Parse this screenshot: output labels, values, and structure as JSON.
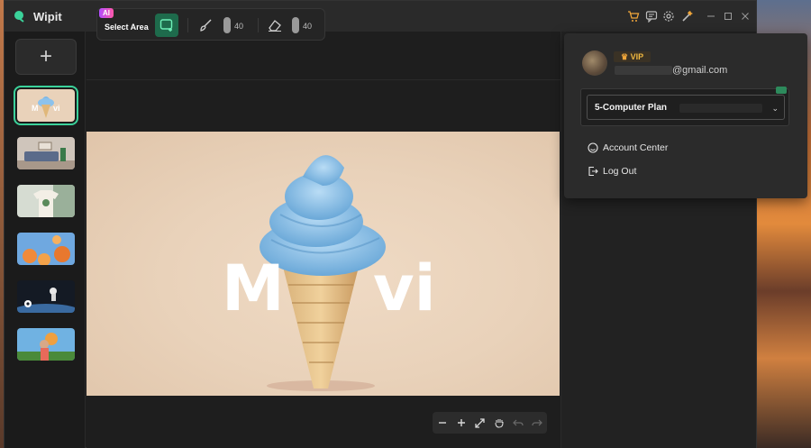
{
  "window": {
    "title": "Wipit"
  },
  "titlebar": {
    "icons": [
      "cart-icon",
      "chat-feedback-icon",
      "gear-icon",
      "tools-icon",
      "minimize-icon",
      "maximize-icon",
      "close-icon"
    ],
    "cart_color": "#f0a63a"
  },
  "sidebar": {
    "add_label": "+",
    "accent_color": "#3bd29a",
    "thumbs": [
      {
        "name": "thumb-ice-cream",
        "colors": [
          "#e9d2ba",
          "#7fb8e6"
        ],
        "active": true
      },
      {
        "name": "thumb-living-room",
        "colors": [
          "#bcb2a8",
          "#5a6b8a"
        ],
        "active": false
      },
      {
        "name": "thumb-tshirt",
        "colors": [
          "#cfd8cf",
          "#f3efe6"
        ],
        "active": false
      },
      {
        "name": "thumb-flowers",
        "colors": [
          "#6fa8e0",
          "#f08a3a"
        ],
        "active": false
      },
      {
        "name": "thumb-astronaut",
        "colors": [
          "#1e2a3a",
          "#d8d8d8"
        ],
        "active": false
      },
      {
        "name": "thumb-girl-flowers",
        "colors": [
          "#6fb0e0",
          "#e8a040"
        ],
        "active": false
      }
    ]
  },
  "toolbar": {
    "ai_badge": "AI",
    "select_area_label": "Select Area",
    "brush_size": "40",
    "eraser_size": "40"
  },
  "canvas": {
    "overlay_text": "M  vi",
    "overlay_text_left": "M",
    "overlay_text_right": "vi"
  },
  "zoom": {
    "icons": [
      "zoom-out-icon",
      "zoom-in-icon",
      "fit-screen-icon",
      "hand-pan-icon",
      "undo-icon",
      "redo-icon"
    ]
  },
  "account": {
    "vip_label": "VIP",
    "email_suffix": "@gmail.com",
    "plan_name": "5-Computer Plan",
    "menu": [
      {
        "label": "Account Center",
        "icon": "account-center-icon"
      },
      {
        "label": "Log Out",
        "icon": "logout-icon"
      }
    ]
  }
}
